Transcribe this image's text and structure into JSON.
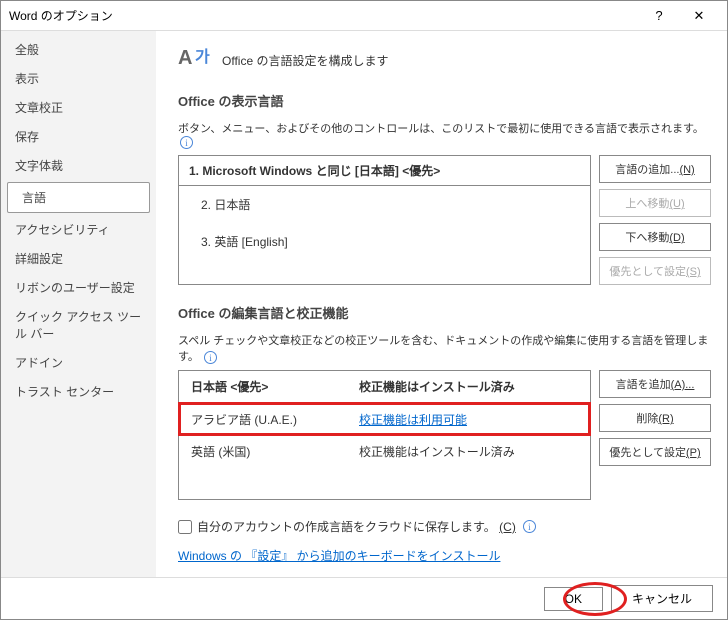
{
  "titlebar": {
    "title": "Word のオプション"
  },
  "sidebar": {
    "items": [
      {
        "label": "全般"
      },
      {
        "label": "表示"
      },
      {
        "label": "文章校正"
      },
      {
        "label": "保存"
      },
      {
        "label": "文字体裁"
      },
      {
        "label": "言語"
      },
      {
        "label": "アクセシビリティ"
      },
      {
        "label": "詳細設定"
      },
      {
        "label": "リボンのユーザー設定"
      },
      {
        "label": "クイック アクセス ツール バー"
      },
      {
        "label": "アドイン"
      },
      {
        "label": "トラスト センター"
      }
    ]
  },
  "content": {
    "header": "Office の言語設定を構成します",
    "display_section": {
      "heading": "Office の表示言語",
      "desc": "ボタン、メニュー、およびその他のコントロールは、このリストで最初に使用できる言語で表示されます。",
      "list_head": "1.     Microsoft Windows と同じ [日本語] <優先>",
      "rows": [
        "2.     日本語",
        "3.     英語 [English]"
      ],
      "btns": {
        "add": "言語の追加...",
        "add_key": "(N)",
        "up": "上へ移動",
        "up_key": "(U)",
        "down": "下へ移動",
        "down_key": "(D)",
        "pref": "優先として設定",
        "pref_key": "(S)"
      }
    },
    "edit_section": {
      "heading": "Office の編集言語と校正機能",
      "desc": "スペル チェックや文章校正などの校正ツールを含む、ドキュメントの作成や編集に使用する言語を管理します。",
      "head": {
        "c1": "日本語 <優先>",
        "c2": "校正機能はインストール済み"
      },
      "rows": [
        {
          "c1": "アラビア語 (U.A.E.)",
          "c2": "校正機能は利用可能",
          "link": true,
          "hl": true
        },
        {
          "c1": "英語 (米国)",
          "c2": "校正機能はインストール済み"
        }
      ],
      "btns": {
        "add": "言語を追加",
        "add_key": "(A)...",
        "remove": "削除",
        "remove_key": "(R)",
        "pref": "優先として設定",
        "pref_key": "(P)"
      }
    },
    "cloud_cb": "自分のアカウントの作成言語をクラウドに保存します。",
    "cloud_key": "(C)",
    "kb_link": "Windows の 『設定』 から追加のキーボードをインストール"
  },
  "footer": {
    "ok": "OK",
    "cancel": "キャンセル"
  }
}
